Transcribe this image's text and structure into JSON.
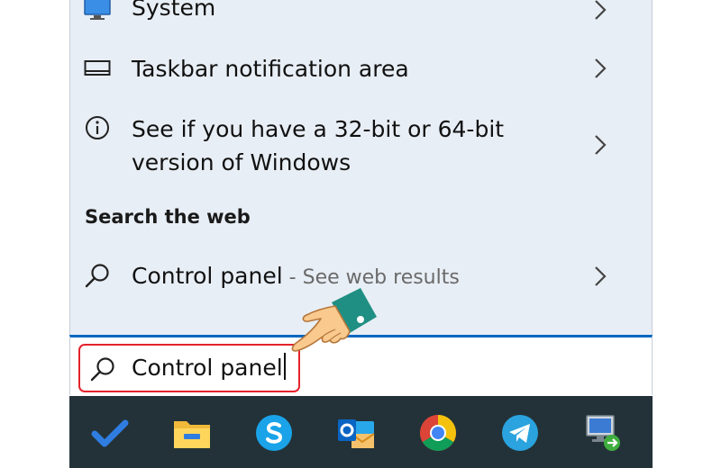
{
  "settings_results": [
    {
      "label": "System",
      "icon": "monitor-icon"
    },
    {
      "label": "Taskbar notification area",
      "icon": "taskbar-icon"
    },
    {
      "label_line1": "See if you have a 32-bit or 64-bit",
      "label_line2": "version of Windows",
      "icon": "info-icon"
    }
  ],
  "web_section": {
    "header": "Search the web",
    "result": {
      "label": "Control panel",
      "suffix": " - See web results",
      "icon": "search-icon"
    }
  },
  "search": {
    "value": "Control panel",
    "icon": "search-icon"
  },
  "taskbar": {
    "apps": [
      {
        "name": "microsoft-todo-icon"
      },
      {
        "name": "file-explorer-icon"
      },
      {
        "name": "skype-icon"
      },
      {
        "name": "outlook-icon"
      },
      {
        "name": "chrome-icon"
      },
      {
        "name": "telegram-icon"
      },
      {
        "name": "remote-desktop-icon"
      }
    ]
  },
  "colors": {
    "panel_bg": "#e8eef5",
    "accent": "#0067c0",
    "highlight_border": "#e3232b",
    "taskbar_bg": "#233238"
  }
}
